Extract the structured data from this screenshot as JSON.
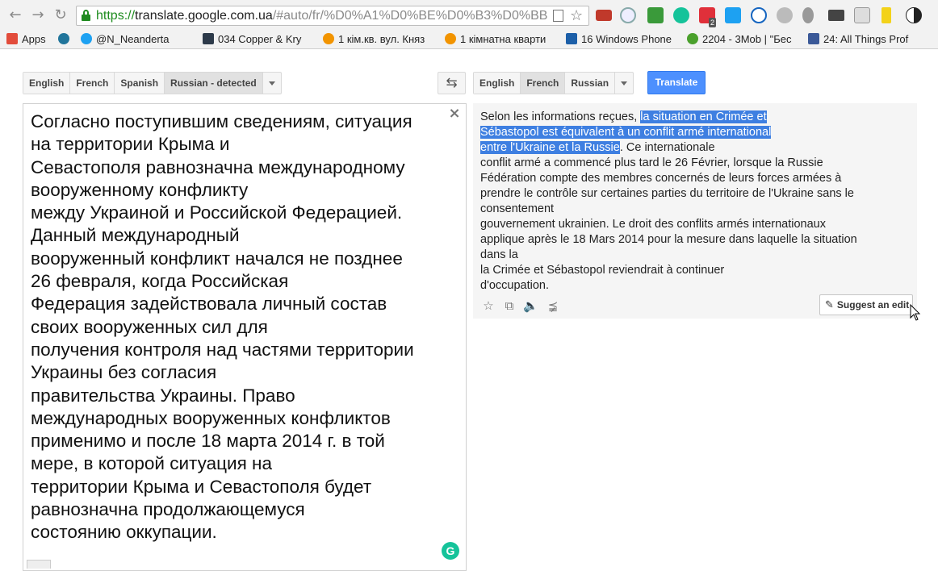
{
  "browser": {
    "url_scheme": "https://",
    "url_host": "translate.google.com.ua",
    "url_path": "/#auto/fr/%D0%A1%D0%BE%D0%B3%D0%BB",
    "extension_badge": "2",
    "bookmarks": [
      {
        "label": "Apps",
        "color": "#e24c3b"
      },
      {
        "label": "",
        "color": "#21759b"
      },
      {
        "label": "@N_Neanderta",
        "color": "#1da1f2"
      },
      {
        "label": "034 Copper & Kry",
        "color": "#2d3a4a"
      },
      {
        "label": "1 кім.кв. вул. Княз",
        "color": "#f29400"
      },
      {
        "label": "1 кімнатна кварти",
        "color": "#f29400"
      },
      {
        "label": "16 Windows Phone",
        "color": "#1c5fa8"
      },
      {
        "label": "2204 - 3Mob | \"Бес",
        "color": "#4aa02c"
      },
      {
        "label": "24: All Things Prof",
        "color": "#3b5998"
      }
    ]
  },
  "source_langs": [
    {
      "label": "English",
      "active": false
    },
    {
      "label": "French",
      "active": false
    },
    {
      "label": "Spanish",
      "active": false
    },
    {
      "label": "Russian - detected",
      "active": true
    }
  ],
  "target_langs": [
    {
      "label": "English",
      "active": false
    },
    {
      "label": "French",
      "active": true
    },
    {
      "label": "Russian",
      "active": false
    }
  ],
  "swap_icon": "swap-arrows-icon",
  "translate_label": "Translate",
  "source_text": "Согласно поступившим сведениям, ситуация\nна территории Крыма и\nСевастополя равнозначна международному\nвооруженному конфликту\nмежду Украиной и Российской Федерацией.\nДанный международный\nвооруженный конфликт начался не позднее\n26 февраля, когда Российская\nФедерация задействовала личный состав\nсвоих вооруженных сил для\nполучения контроля над частями территории\nУкраины без согласия\nправительства Украины. Право\nмеждународных вооруженных конфликтов\nприменимо и после 18 марта 2014 г. в той\nмере, в которой ситуация на\nтерритории Крыма и Севастополя будет\nравнозначна продолжающемуся\nсостоянию оккупации.",
  "clear_glyph": "×",
  "grammarly_badge": "G",
  "result_lines": [
    {
      "plain": "Selon les informations reçues, ",
      "highlight": "la situation en Crimée et",
      "tail": ""
    },
    {
      "plain": "",
      "highlight": "Sébastopol est équivalent à un conflit armé international",
      "tail": ""
    },
    {
      "plain": "",
      "highlight": "entre l'Ukraine et la Russie",
      "tail": ". Ce internationale"
    },
    {
      "plain": "conflit armé a commencé plus tard le 26 Février, lorsque la Russie",
      "highlight": "",
      "tail": ""
    },
    {
      "plain": "Fédération compte des membres concernés de leurs forces armées à",
      "highlight": "",
      "tail": ""
    },
    {
      "plain": "prendre le contrôle sur certaines parties du territoire de l'Ukraine sans le",
      "highlight": "",
      "tail": ""
    },
    {
      "plain": "consentement",
      "highlight": "",
      "tail": ""
    },
    {
      "plain": "gouvernement ukrainien. Le droit des conflits armés internationaux",
      "highlight": "",
      "tail": ""
    },
    {
      "plain": "applique après le 18 Mars 2014 pour la mesure dans laquelle la situation",
      "highlight": "",
      "tail": ""
    },
    {
      "plain": "dans la",
      "highlight": "",
      "tail": ""
    },
    {
      "plain": "la Crimée et Sébastopol reviendrait à continuer",
      "highlight": "",
      "tail": ""
    },
    {
      "plain": "d'occupation.",
      "highlight": "",
      "tail": ""
    }
  ],
  "result_icons": [
    "star-icon",
    "copy-icon",
    "speaker-icon",
    "share-icon"
  ],
  "suggest_edit_label": "Suggest an edit"
}
